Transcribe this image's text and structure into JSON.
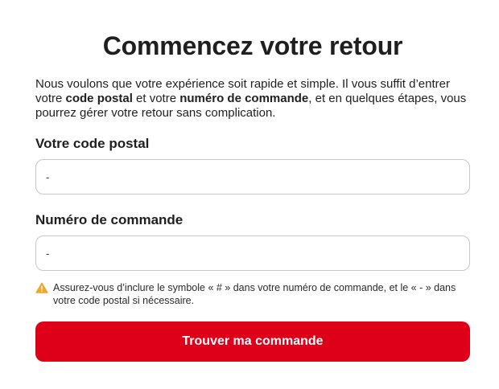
{
  "header": {
    "title": "Commencez votre retour"
  },
  "intro": {
    "part1": "Nous voulons que votre expérience soit rapide et simple. Il vous suffit d’entrer votre ",
    "bold1": "code postal",
    "part2": " et votre ",
    "bold2": "numéro de commande",
    "part3": ", et en quelques étapes, vous pourrez gérer votre retour sans complication."
  },
  "form": {
    "postal_label": "Votre code postal",
    "postal_value": "-",
    "order_label": "Numéro de commande",
    "order_value": "-",
    "note_icon": "warning-icon",
    "note_text": "Assurez-vous d’inclure le symbole « # » dans votre numéro de commande, et le « - » dans votre code postal si nécessaire.",
    "submit_label": "Trouver ma commande"
  },
  "colors": {
    "accent": "#dd0018",
    "warning": "#f5a623"
  }
}
